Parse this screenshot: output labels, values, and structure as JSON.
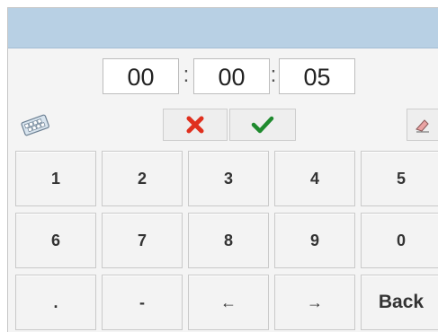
{
  "time": {
    "hours": "00",
    "minutes": "00",
    "seconds": "05",
    "separator": ":"
  },
  "toolbar": {
    "keyboard_icon": "keyboard-icon",
    "cancel_icon": "red-x-icon",
    "confirm_icon": "green-check-icon",
    "clear_icon": "eraser-icon"
  },
  "keypad": {
    "rows": [
      [
        "1",
        "2",
        "3",
        "4",
        "5"
      ],
      [
        "6",
        "7",
        "8",
        "9",
        "0"
      ],
      [
        ".",
        "-",
        "←",
        "→",
        "Back"
      ]
    ]
  },
  "colors": {
    "titlebar": "#b8d0e4",
    "cancel": "#e0301e",
    "confirm": "#1f8a2e"
  }
}
